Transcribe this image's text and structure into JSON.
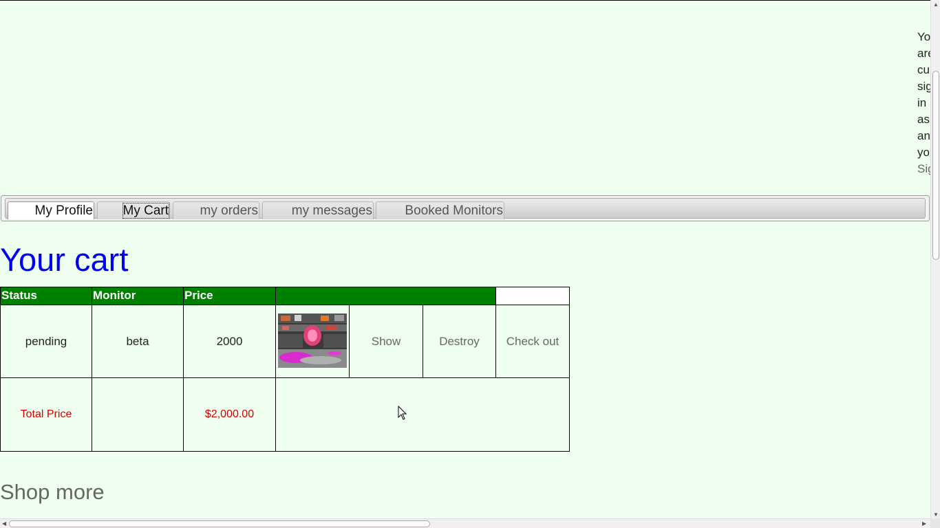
{
  "signin": {
    "lines": [
      "You",
      "are",
      "currently",
      "signed",
      "in",
      "as",
      "an",
      "you"
    ],
    "signout_label": "Sign out"
  },
  "tabs": [
    {
      "label": "My Profile",
      "state": "white"
    },
    {
      "label": "My Cart",
      "state": "active"
    },
    {
      "label": "my orders",
      "state": "normal"
    },
    {
      "label": "my messages",
      "state": "normal"
    },
    {
      "label": "Booked Monitors",
      "state": "normal"
    }
  ],
  "page_title": "Your cart",
  "cart_table": {
    "headers": [
      "Status",
      "Monitor",
      "Price",
      ""
    ],
    "row": {
      "status": "pending",
      "monitor": "beta",
      "price": "2000",
      "image_icon": "mall-display-thumbnail",
      "show_label": "Show",
      "destroy_label": "Destroy",
      "checkout_label": "Check out"
    },
    "total": {
      "label": "Total Price",
      "value": "$2,000.00"
    }
  },
  "shop_more_label": "Shop more",
  "colors": {
    "background": "#efffef",
    "header_green": "#008000",
    "title_blue": "#0000ee",
    "total_red": "#d40000"
  }
}
